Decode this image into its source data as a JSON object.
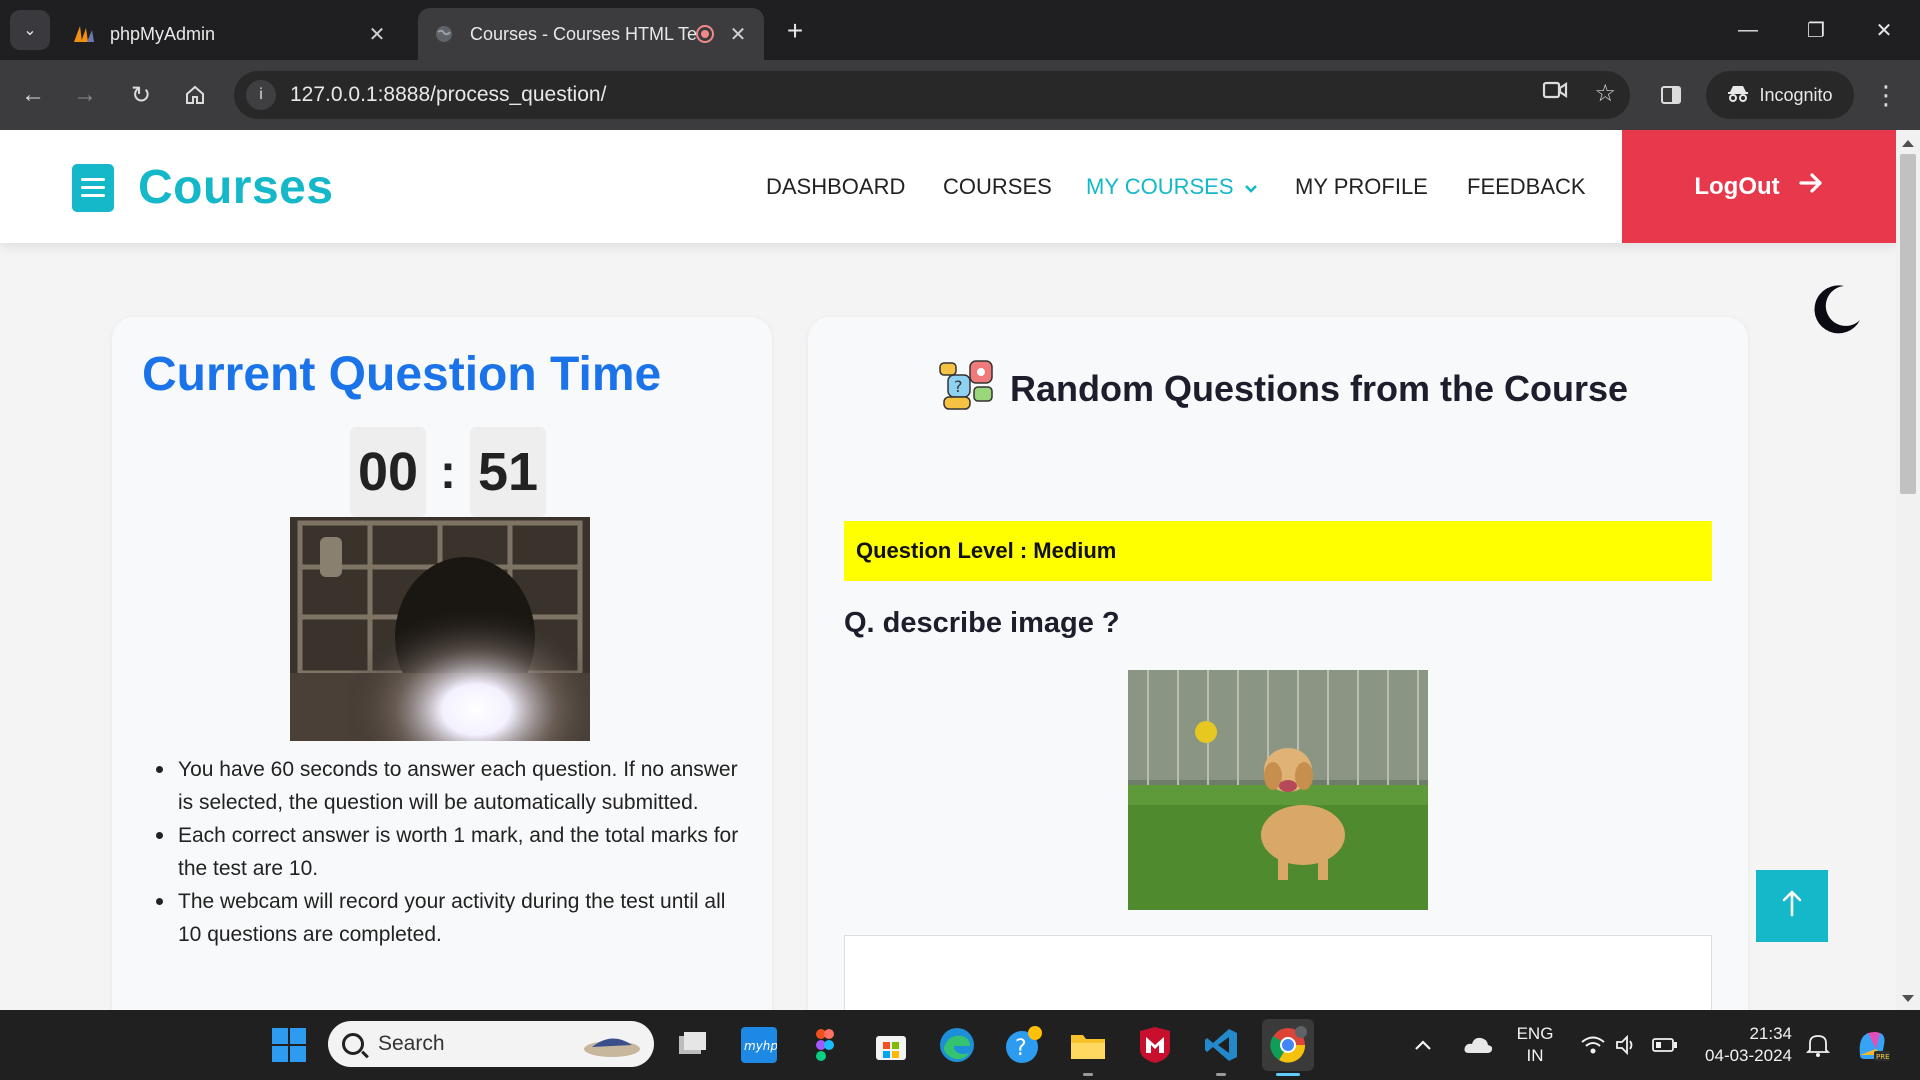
{
  "browser": {
    "tabs": [
      {
        "title": "phpMyAdmin",
        "active": false
      },
      {
        "title": "Courses - Courses HTML Te",
        "active": true
      }
    ],
    "url": "127.0.0.1:8888/process_question/",
    "incognito_label": "Incognito"
  },
  "site": {
    "brand": "Courses",
    "nav": [
      "DASHBOARD",
      "COURSES",
      "MY COURSES",
      "MY PROFILE",
      "FEEDBACK"
    ],
    "logout_label": "LogOut",
    "accent_color": "#14b8c8",
    "logout_color": "#e8394c"
  },
  "timer_card": {
    "heading": "Current Question Time",
    "minutes": "00",
    "separator": ":",
    "seconds": "51",
    "rules": [
      "You have 60 seconds to answer each question. If no answer is selected, the question will be automatically submitted.",
      "Each correct answer is worth 1 mark, and the total marks for the test are 10.",
      "The webcam will record your activity during the test until all 10 questions are completed."
    ]
  },
  "question_card": {
    "title": "Random Questions from the Course",
    "level_label": "Question Level : Medium",
    "question": "Q. describe image ?"
  },
  "taskbar": {
    "search_placeholder": "Search",
    "lang_top": "ENG",
    "lang_bottom": "IN",
    "time": "21:34",
    "date": "04-03-2024"
  }
}
